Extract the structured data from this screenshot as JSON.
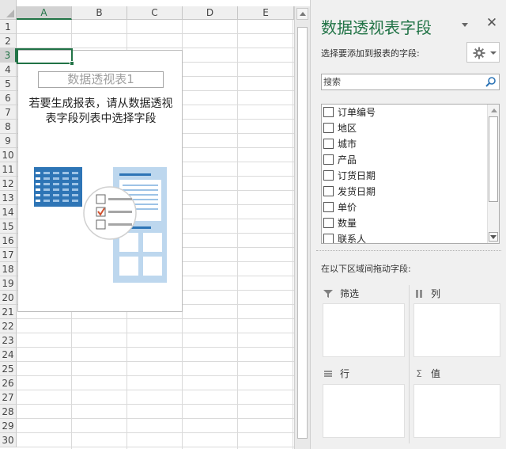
{
  "sheet": {
    "columns": [
      "A",
      "B",
      "C",
      "D",
      "E"
    ],
    "rows": [
      "1",
      "2",
      "3",
      "4",
      "5",
      "6",
      "7",
      "8",
      "9",
      "10",
      "11",
      "12",
      "13",
      "14",
      "15",
      "16",
      "17",
      "18",
      "19",
      "20",
      "21",
      "22",
      "23",
      "24",
      "25",
      "26",
      "27",
      "28",
      "29",
      "30"
    ],
    "selected_column": "A",
    "selected_row": "3",
    "pivot": {
      "name": "数据透视表1",
      "instruction_line1": "若要生成报表，请从数据透视",
      "instruction_line2": "表字段列表中选择字段",
      "illustration_icon": "pivot-placeholder-illustration"
    }
  },
  "pane": {
    "title": "数据透视表字段",
    "choose_label": "选择要添加到报表的字段:",
    "tools_icon": "gear-icon",
    "search_placeholder": "搜索",
    "fields": [
      {
        "label": "订单编号",
        "checked": false
      },
      {
        "label": "地区",
        "checked": false
      },
      {
        "label": "城市",
        "checked": false
      },
      {
        "label": "产品",
        "checked": false
      },
      {
        "label": "订货日期",
        "checked": false
      },
      {
        "label": "发货日期",
        "checked": false
      },
      {
        "label": "单价",
        "checked": false
      },
      {
        "label": "数量",
        "checked": false
      },
      {
        "label": "联系人",
        "checked": false
      }
    ],
    "drag_label": "在以下区域间拖动字段:",
    "areas": {
      "filters": "筛选",
      "columns": "列",
      "rows": "行",
      "values": "值"
    }
  },
  "colors": {
    "accent": "#217346",
    "pane_background": "#f0f0f0",
    "illustration_blue": "#2e75b6",
    "check_orange": "#d35230"
  }
}
